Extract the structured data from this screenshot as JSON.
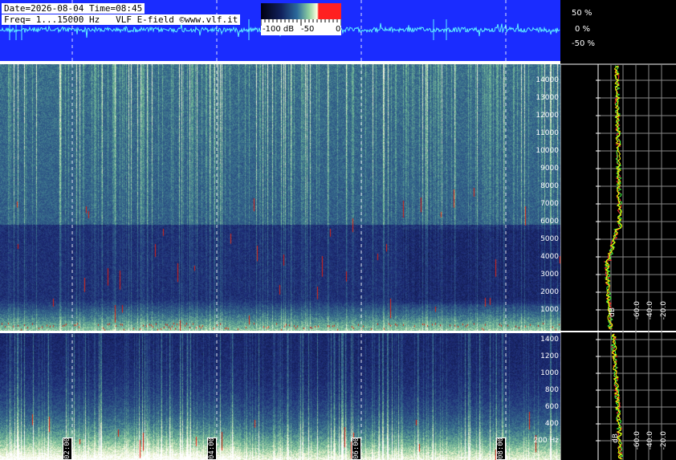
{
  "header": {
    "date_line": "Date=2026-08-04 Time=08:45",
    "freq_line": "Freq= 1...15000 Hz   VLF E-field ©www.vlf.it"
  },
  "colorbar": {
    "labels": [
      "-100 dB",
      "-50",
      "0"
    ]
  },
  "waveform_scale": [
    "50 %",
    "0 %",
    "-50 %"
  ],
  "time_axis": [
    "02:00",
    "04:00",
    "06:00",
    "08:00"
  ],
  "upper_freq_axis": [
    "14000",
    "13000",
    "12000",
    "11000",
    "10000",
    "9000",
    "8000",
    "7000",
    "6000",
    "5000",
    "4000",
    "3000",
    "2000",
    "1000"
  ],
  "lower_freq_axis": [
    "1400",
    "1200",
    "1000",
    "800",
    "600",
    "400",
    "200 Hz"
  ],
  "db_axis_upper": [
    "dB",
    "-60.0",
    "-40.0",
    "-20.0",
    "dB"
  ],
  "db_axis_lower": [
    "dB",
    "-60.0",
    "-40.0",
    "-20.0",
    "dB"
  ],
  "colors": {
    "waveform_bg": "#1a2cff",
    "waveform_trace": "#5ff0ff",
    "spectrum_line_1": "#ffff00",
    "spectrum_line_2": "#ff3030",
    "spectrum_line_3": "#40ff40"
  }
}
